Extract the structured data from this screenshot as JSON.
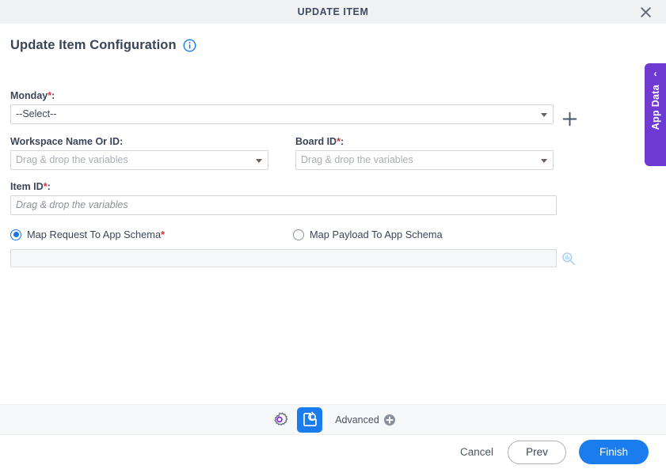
{
  "window": {
    "title": "UPDATE ITEM",
    "close_icon": "close-icon"
  },
  "page": {
    "heading": "Update Item Configuration",
    "info_icon": "info-icon"
  },
  "fields": {
    "monday": {
      "label": "Monday",
      "required_mark": "*",
      "colon": ":",
      "value": "--Select--",
      "add_icon": "plus-icon"
    },
    "workspace": {
      "label": "Workspace Name Or ID",
      "colon": ":",
      "placeholder": "Drag & drop the variables"
    },
    "board": {
      "label": "Board ID",
      "required_mark": "*",
      "colon": ":",
      "placeholder": "Drag & drop the variables"
    },
    "item": {
      "label": "Item ID",
      "required_mark": "*",
      "colon": ":",
      "placeholder": "Drag & drop the variables"
    }
  },
  "schema": {
    "option_request": "Map Request To App Schema",
    "option_request_required": "*",
    "option_payload": "Map Payload To App Schema",
    "selected": "request",
    "input_value": "",
    "search_icon": "search-icon"
  },
  "app_data_tab": {
    "label": "App Data",
    "chevron": "‹",
    "color": "#6f3ad2"
  },
  "toolbar": {
    "gear_icon": "gear-icon",
    "update_icon": "update-refresh-icon",
    "advanced_label": "Advanced",
    "advanced_add_icon": "plus-circle-icon"
  },
  "footer": {
    "cancel_label": "Cancel",
    "prev_label": "Prev",
    "finish_label": "Finish"
  },
  "colors": {
    "accent_blue": "#1b7ced",
    "required_red": "#d0323c",
    "purple": "#6f3ad2",
    "titlebar_bg": "#f0f1f3",
    "toolbar_bg": "#f7f8fa"
  }
}
